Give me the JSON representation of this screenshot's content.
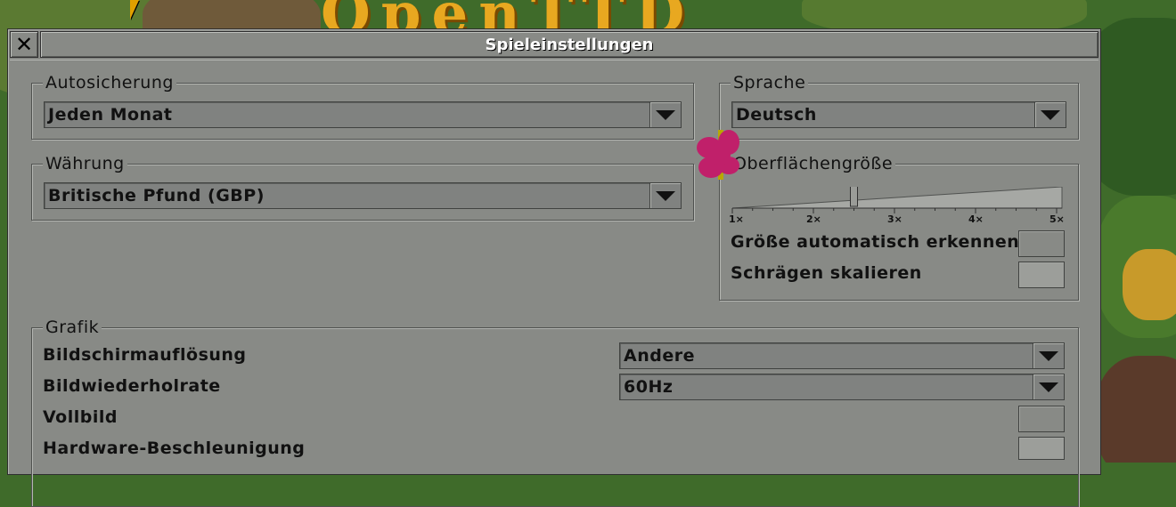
{
  "window": {
    "title": "Spieleinstellungen",
    "close_symbol": "✕"
  },
  "autosave": {
    "frame_title": "Autosicherung",
    "value": "Jeden Monat"
  },
  "currency": {
    "frame_title": "Währung",
    "value": "Britische Pfund (GBP)"
  },
  "language": {
    "frame_title": "Sprache",
    "value": "Deutsch"
  },
  "interface_size": {
    "frame_title": "Oberflächengröße",
    "scale_labels": [
      "1×",
      "2×",
      "3×",
      "4×",
      "5×"
    ],
    "slider_value": 2.5,
    "auto_detect_label": "Größe automatisch erkennen",
    "scale_bevels_label": "Schrägen skalieren"
  },
  "graphics": {
    "frame_title": "Grafik",
    "resolution_label": "Bildschirmauflösung",
    "resolution_value": "Andere",
    "refresh_label": "Bildwiederholrate",
    "refresh_value": "60Hz",
    "fullscreen_label": "Vollbild",
    "hw_accel_label": "Hardware-Beschleunigung"
  },
  "background": {
    "logo_text": "OpenTTD"
  }
}
